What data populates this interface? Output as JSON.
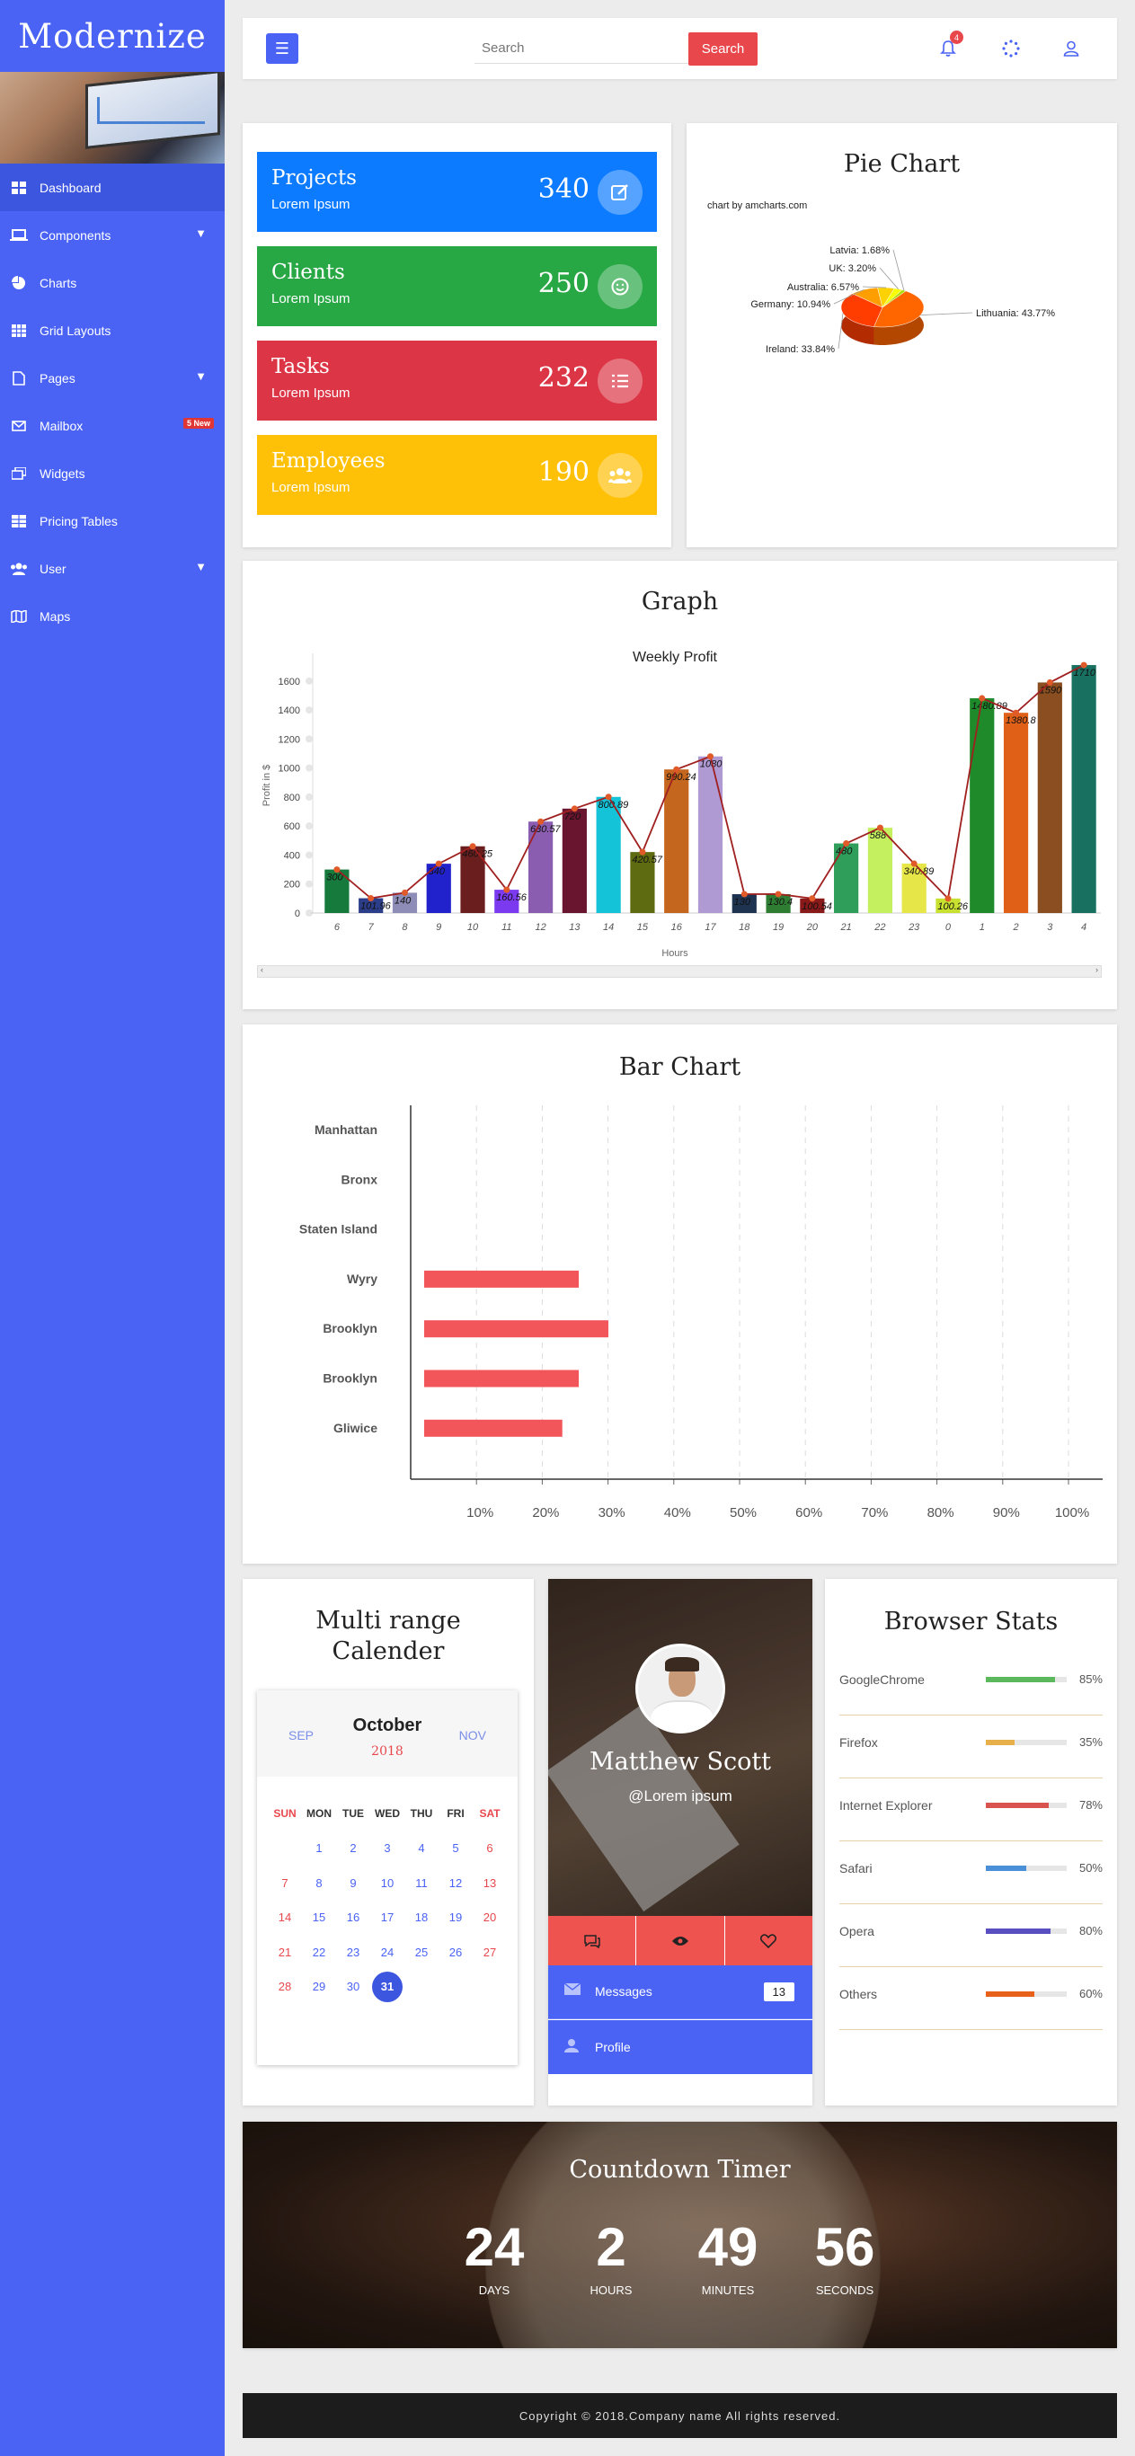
{
  "brand": "Modernize",
  "sidebar": {
    "items": [
      {
        "label": "Dashboard",
        "icon": "grid-icon"
      },
      {
        "label": "Components",
        "icon": "laptop-icon"
      },
      {
        "label": "Charts",
        "icon": "pie-icon"
      },
      {
        "label": "Grid Layouts",
        "icon": "table-icon"
      },
      {
        "label": "Pages",
        "icon": "file-icon"
      },
      {
        "label": "Mailbox",
        "icon": "mail-icon",
        "badge": "5 New"
      },
      {
        "label": "Widgets",
        "icon": "window-icon"
      },
      {
        "label": "Pricing Tables",
        "icon": "table-icon"
      },
      {
        "label": "User",
        "icon": "users-icon"
      },
      {
        "label": "Maps",
        "icon": "map-icon"
      }
    ]
  },
  "topbar": {
    "search_placeholder": "Search",
    "search_button": "Search",
    "notification_count": "4"
  },
  "stats": [
    {
      "title": "Projects",
      "sub": "Lorem Ipsum",
      "value": "340",
      "color": "#0d7bff",
      "icon": "edit-icon"
    },
    {
      "title": "Clients",
      "sub": "Lorem Ipsum",
      "value": "250",
      "color": "#28a745",
      "icon": "smile-icon"
    },
    {
      "title": "Tasks",
      "sub": "Lorem Ipsum",
      "value": "232",
      "color": "#dc3545",
      "icon": "list-icon"
    },
    {
      "title": "Employees",
      "sub": "Lorem Ipsum",
      "value": "190",
      "color": "#ffc107",
      "icon": "users-icon"
    }
  ],
  "pie": {
    "title": "Pie Chart",
    "credit": "chart by amcharts.com"
  },
  "graph": {
    "title": "Graph"
  },
  "barchart": {
    "title": "Bar Chart"
  },
  "calendar": {
    "title_line1": "Multi range",
    "title_line2": "Calender",
    "month": "October",
    "year": "2018",
    "prev": "SEP",
    "next": "NOV",
    "dow": [
      "SUN",
      "MON",
      "TUE",
      "WED",
      "THU",
      "FRI",
      "SAT"
    ],
    "weeks": [
      [
        "",
        "1",
        "2",
        "3",
        "4",
        "5",
        "6"
      ],
      [
        "7",
        "8",
        "9",
        "10",
        "11",
        "12",
        "13"
      ],
      [
        "14",
        "15",
        "16",
        "17",
        "18",
        "19",
        "20"
      ],
      [
        "21",
        "22",
        "23",
        "24",
        "25",
        "26",
        "27"
      ],
      [
        "28",
        "29",
        "30",
        "31",
        "",
        "",
        ""
      ]
    ],
    "selected": "31"
  },
  "profile": {
    "name": "Matthew Scott",
    "handle": "@Lorem ipsum",
    "messages_label": "Messages",
    "messages_count": "13",
    "profile_label": "Profile"
  },
  "browser_stats": {
    "title": "Browser Stats",
    "items": [
      {
        "name": "GoogleChrome",
        "pct": "85%",
        "value": 0.85,
        "color": "#5cb85c"
      },
      {
        "name": "Firefox",
        "pct": "35%",
        "value": 0.35,
        "color": "#e8b04a"
      },
      {
        "name": "Internet Explorer",
        "pct": "78%",
        "value": 0.78,
        "color": "#d9534f"
      },
      {
        "name": "Safari",
        "pct": "50%",
        "value": 0.5,
        "color": "#4a90d9"
      },
      {
        "name": "Opera",
        "pct": "80%",
        "value": 0.8,
        "color": "#5a4fc0"
      },
      {
        "name": "Others",
        "pct": "60%",
        "value": 0.6,
        "color": "#e8611a"
      }
    ]
  },
  "countdown": {
    "title": "Countdown Timer",
    "days": "24",
    "days_label": "DAYS",
    "hours": "2",
    "hours_label": "HOURS",
    "minutes": "49",
    "minutes_label": "MINUTES",
    "seconds": "56",
    "seconds_label": "SECONDS"
  },
  "footer": {
    "copyright": "Copyright © 2018.Company name All rights reserved."
  },
  "chart_data": [
    {
      "type": "pie",
      "title": "",
      "slices": [
        {
          "label": "Lithuania",
          "value": 43.77,
          "color": "#ff6600"
        },
        {
          "label": "Ireland",
          "value": 33.84,
          "color": "#ff3d00"
        },
        {
          "label": "Germany",
          "value": 10.94,
          "color": "#ff9e01"
        },
        {
          "label": "Australia",
          "value": 6.57,
          "color": "#fcd202"
        },
        {
          "label": "UK",
          "value": 3.2,
          "color": "#f8ff01"
        },
        {
          "label": "Latvia",
          "value": 1.68,
          "color": "#b0de09"
        }
      ]
    },
    {
      "type": "bar",
      "title": "Weekly Profit",
      "xlabel": "Hours",
      "ylabel": "Profit in $",
      "ylim": [
        0,
        1600
      ],
      "yticks": [
        0,
        200,
        400,
        600,
        800,
        1000,
        1200,
        1400,
        1600
      ],
      "categories": [
        "6",
        "7",
        "8",
        "9",
        "10",
        "11",
        "12",
        "13",
        "14",
        "15",
        "16",
        "17",
        "18",
        "19",
        "20",
        "21",
        "22",
        "23",
        "0",
        "1",
        "2",
        "3",
        "4"
      ],
      "values": [
        300,
        101.96,
        140,
        340,
        460.25,
        160.56,
        630.57,
        720,
        800.89,
        420.57,
        990.24,
        1080,
        130,
        130.4,
        100.54,
        480,
        588,
        340.89,
        100.26,
        1480.89,
        1380.8,
        1590,
        1710
      ],
      "data_labels": [
        "300",
        "101.96",
        "140",
        "340",
        "460.25",
        "160.56",
        "630.57",
        "720",
        "800.89",
        "420.57",
        "990.24",
        "1080",
        "130",
        "130.4",
        "100.54",
        "480",
        "588",
        "340.89",
        "100.26",
        "1480.89",
        "1380.8",
        "1590",
        "1710"
      ],
      "colors": [
        "#167a3d",
        "#2c3e8a",
        "#8d8db8",
        "#2222cc",
        "#6b1e1e",
        "#7b3af0",
        "#8a5db0",
        "#6a1530",
        "#15c3d8",
        "#5e6b10",
        "#c4661e",
        "#b09ad4",
        "#1e3350",
        "#2e7d32",
        "#8a1a1a",
        "#2e9e5a",
        "#c4f060",
        "#e6e648",
        "#c8e030",
        "#1e8a2a",
        "#e06018",
        "#8a4e20",
        "#187060"
      ],
      "line_color": "#a02020"
    },
    {
      "type": "bar",
      "orientation": "horizontal",
      "title": "",
      "categories": [
        "Manhattan",
        "Bronx",
        "Staten Island",
        "Wyry",
        "Brooklyn",
        "Brooklyn",
        "Gliwice"
      ],
      "values": [
        0,
        0,
        0,
        23.5,
        28,
        23.5,
        21
      ],
      "xticks": [
        "10%",
        "20%",
        "30%",
        "40%",
        "50%",
        "60%",
        "70%",
        "80%",
        "90%",
        "100%"
      ],
      "xlim": [
        0,
        100
      ],
      "color": "#f2555a"
    }
  ]
}
